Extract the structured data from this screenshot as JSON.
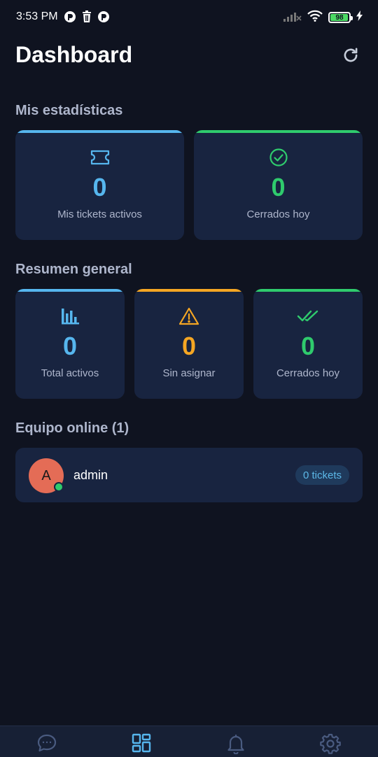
{
  "status_bar": {
    "time": "3:53 PM",
    "battery": "98",
    "icons": [
      "app-notification-icon",
      "trash-icon",
      "app-notification-icon",
      "signal-icon",
      "wifi-icon",
      "battery-icon",
      "charging-icon"
    ]
  },
  "header": {
    "title": "Dashboard",
    "refresh_icon": "refresh-icon"
  },
  "my_stats": {
    "title": "Mis estadísticas",
    "cards": [
      {
        "icon": "ticket-icon",
        "value": "0",
        "label": "Mis tickets activos",
        "color": "#56b6ee"
      },
      {
        "icon": "check-circle-icon",
        "value": "0",
        "label": "Cerrados hoy",
        "color": "#2fcb6d"
      }
    ]
  },
  "summary": {
    "title": "Resumen general",
    "cards": [
      {
        "icon": "bar-chart-icon",
        "value": "0",
        "label": "Total activos",
        "color": "#56b6ee"
      },
      {
        "icon": "warning-icon",
        "value": "0",
        "label": "Sin asignar",
        "color": "#f5a623"
      },
      {
        "icon": "double-check-icon",
        "value": "0",
        "label": "Cerrados hoy",
        "color": "#2fcb6d"
      }
    ]
  },
  "team": {
    "title": "Equipo online (1)",
    "members": [
      {
        "initial": "A",
        "name": "admin",
        "tickets": "0 tickets",
        "status": "online"
      }
    ]
  },
  "bottom_nav": {
    "items": [
      {
        "icon": "chat-icon",
        "active": false
      },
      {
        "icon": "dashboard-icon",
        "active": true
      },
      {
        "icon": "bell-icon",
        "active": false
      },
      {
        "icon": "settings-icon",
        "active": false
      }
    ]
  },
  "colors": {
    "background": "#0f1320",
    "card": "#182440",
    "accent_blue": "#56b6ee",
    "accent_green": "#2fcb6d",
    "accent_orange": "#f5a623",
    "muted_text": "#aeb6cc",
    "avatar": "#e46c56"
  }
}
